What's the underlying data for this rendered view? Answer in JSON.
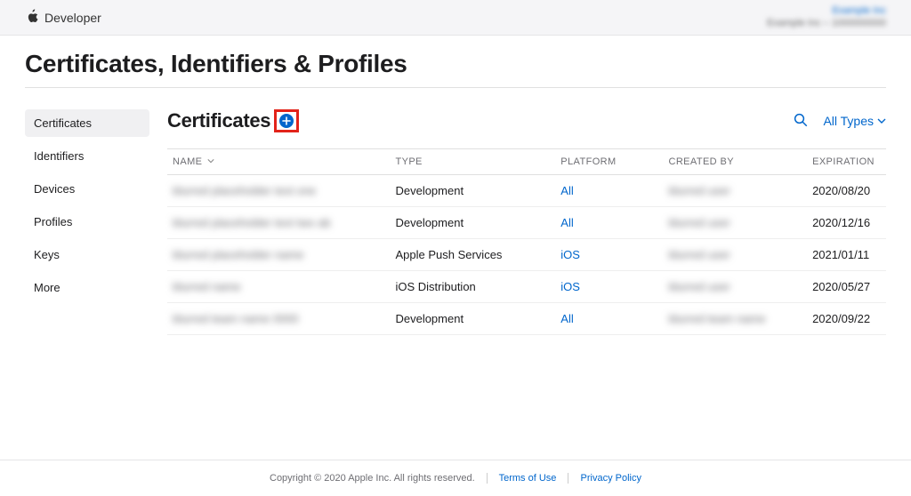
{
  "header": {
    "brand": "Developer",
    "account_name": "Example Inc",
    "account_sub": "Example Inc – 1000000000"
  },
  "page_title": "Certificates, Identifiers & Profiles",
  "sidebar": {
    "items": [
      {
        "label": "Certificates",
        "active": true
      },
      {
        "label": "Identifiers",
        "active": false
      },
      {
        "label": "Devices",
        "active": false
      },
      {
        "label": "Profiles",
        "active": false
      },
      {
        "label": "Keys",
        "active": false
      },
      {
        "label": "More",
        "active": false
      }
    ]
  },
  "section": {
    "title": "Certificates",
    "filter_label": "All Types"
  },
  "table": {
    "columns": {
      "name": "NAME",
      "type": "TYPE",
      "platform": "PLATFORM",
      "created_by": "CREATED BY",
      "expiration": "EXPIRATION"
    },
    "rows": [
      {
        "name": "blurred placeholder text one",
        "type": "Development",
        "platform": "All",
        "created_by": "blurred user",
        "expiration": "2020/08/20"
      },
      {
        "name": "blurred placeholder text two ab",
        "type": "Development",
        "platform": "All",
        "created_by": "blurred user",
        "expiration": "2020/12/16"
      },
      {
        "name": "blurred placeholder name",
        "type": "Apple Push Services",
        "platform": "iOS",
        "created_by": "blurred user",
        "expiration": "2021/01/11"
      },
      {
        "name": "blurred name",
        "type": "iOS Distribution",
        "platform": "iOS",
        "created_by": "blurred user",
        "expiration": "2020/05/27"
      },
      {
        "name": "blurred team name 0000",
        "type": "Development",
        "platform": "All",
        "created_by": "blurred team name",
        "expiration": "2020/09/22"
      }
    ]
  },
  "footer": {
    "copyright": "Copyright © 2020 Apple Inc. All rights reserved.",
    "terms": "Terms of Use",
    "privacy": "Privacy Policy"
  }
}
